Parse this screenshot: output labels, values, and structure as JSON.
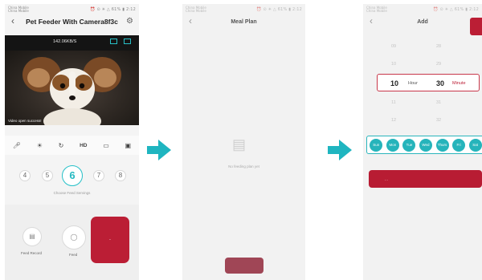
{
  "screen1": {
    "status_left": "China Mobile\nChina Mobile",
    "status_right": "⏰ ⊙ ✳ △ 61% ▮ 2:12",
    "title": "Pet Feeder With Camera8f3c",
    "speed": "142.06KB/S",
    "video_status": "Video open success!",
    "ctrl_hd": "HD",
    "portions": [
      "4",
      "5",
      "6",
      "7",
      "8"
    ],
    "portion_label": "Choose Feed Servings",
    "feed_record_label": "Feed Record",
    "feed_label": "Feed",
    "manual_feed_label": "-"
  },
  "screen2": {
    "title": "Meal Plan",
    "empty_text": "No feeding plan yet"
  },
  "screen3": {
    "title": "Add",
    "picker_above": [
      [
        "09",
        "28"
      ],
      [
        "10",
        "29"
      ]
    ],
    "hour_value": "10",
    "hour_label": "Hour",
    "minute_value": "30",
    "minute_label": "Minute",
    "picker_below": [
      [
        "11",
        "31"
      ],
      [
        "12",
        "32"
      ]
    ],
    "days": [
      "Sun",
      "Mon",
      "Tue",
      "Wed",
      "Thurs",
      "Fri",
      "Sat"
    ],
    "confirm_label": "-      -"
  },
  "colors": {
    "accent_teal": "#26b4bb",
    "accent_red": "#bb1e35",
    "arrow_teal": "#1fb5c0"
  }
}
